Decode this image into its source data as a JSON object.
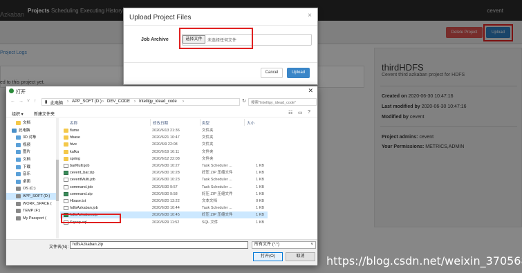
{
  "navbar": {
    "brand": "Azkaban",
    "items": [
      "Projects",
      "Scheduling",
      "Executing",
      "History"
    ],
    "user": "cevent"
  },
  "project_page": {
    "delete_label": "Delete Project",
    "upload_label": "Upload",
    "project_logs": "Project Logs",
    "no_flows": "ed to this project yet.",
    "info": {
      "title": "thirdHDFS",
      "description": "Cevent third azkaban project for HDFS",
      "created_label": "Created on",
      "created_value": "2020-06-30 10:47:16",
      "modified_label": "Last modified by",
      "modified_value": "2020-06-30 10:47:16",
      "modified_by_label": "Modified by",
      "modified_by_value": "cevent",
      "admins_label": "Project admins:",
      "admins_value": "cevent",
      "permissions_label": "Your Permissions:",
      "permissions_value": "METRICS,ADMIN"
    }
  },
  "modal": {
    "title": "Upload Project Files",
    "close": "×",
    "job_archive_label": "Job Archive",
    "choose_file": "选择文件",
    "no_file": "未选择任何文件",
    "cancel": "Cancel",
    "upload": "Upload"
  },
  "dialog": {
    "title": "打开",
    "close": "✕",
    "breadcrumb": [
      "此电脑",
      "APP_SOFT (D:)",
      "DEV_CODE",
      "Intelligy_idead_code"
    ],
    "search_placeholder": "搜索\"Intelligy_idead_code\"",
    "organize": "组织 ▾",
    "new_folder": "新建文件夹",
    "columns": {
      "name": "名称",
      "date": "修改日期",
      "type": "类型",
      "size": "大小"
    },
    "nav_items": [
      {
        "label": "文档",
        "icon": "folder"
      },
      {
        "label": "此电脑",
        "icon": "pc"
      },
      {
        "label": "3D 对象",
        "icon": "blue"
      },
      {
        "label": "视频",
        "icon": "blue"
      },
      {
        "label": "图片",
        "icon": "blue"
      },
      {
        "label": "文档",
        "icon": "blue"
      },
      {
        "label": "下载",
        "icon": "blue"
      },
      {
        "label": "音乐",
        "icon": "blue"
      },
      {
        "label": "桌面",
        "icon": "blue"
      },
      {
        "label": "OS (C:)",
        "icon": "drive"
      },
      {
        "label": "APP_SOFT (D:)",
        "icon": "drive"
      },
      {
        "label": "WORK_SPACE (",
        "icon": "drive"
      },
      {
        "label": "TEMP (F:)",
        "icon": "drive"
      },
      {
        "label": "My Passport (",
        "icon": "drive"
      }
    ],
    "files": [
      {
        "name": "flume",
        "date": "2020/6/13 21:36",
        "type": "文件夹",
        "size": "",
        "icon": "folder"
      },
      {
        "name": "hbase",
        "date": "2020/6/21 10:47",
        "type": "文件夹",
        "size": "",
        "icon": "folder"
      },
      {
        "name": "hive",
        "date": "2020/6/9 22:08",
        "type": "文件夹",
        "size": "",
        "icon": "folder"
      },
      {
        "name": "kafka",
        "date": "2020/6/19 16:11",
        "type": "文件夹",
        "size": "",
        "icon": "folder"
      },
      {
        "name": "spring",
        "date": "2020/6/12 22:08",
        "type": "文件夹",
        "size": "",
        "icon": "folder"
      },
      {
        "name": "barMulti.job",
        "date": "2020/6/30 10:27",
        "type": "Task Scheduler ...",
        "size": "1 KB",
        "icon": "file"
      },
      {
        "name": "cevent_bar.zip",
        "date": "2020/6/30 10:28",
        "type": "好压 ZIP 压缩文件",
        "size": "1 KB",
        "icon": "zip"
      },
      {
        "name": "ceventMulti.job",
        "date": "2020/6/30 10:23",
        "type": "Task Scheduler ...",
        "size": "1 KB",
        "icon": "file"
      },
      {
        "name": "command.job",
        "date": "2020/6/30 9:57",
        "type": "Task Scheduler ...",
        "size": "1 KB",
        "icon": "file"
      },
      {
        "name": "command.zip",
        "date": "2020/6/30 9:58",
        "type": "好压 ZIP 压缩文件",
        "size": "1 KB",
        "icon": "zip"
      },
      {
        "name": "Hbase.txt",
        "date": "2020/6/20 13:22",
        "type": "文本文档",
        "size": "0 KB",
        "icon": "file"
      },
      {
        "name": "hdfsAzkaban.job",
        "date": "2020/6/30 10:44",
        "type": "Task Scheduler ...",
        "size": "1 KB",
        "icon": "file"
      },
      {
        "name": "hdfsAzkaban.zip",
        "date": "2020/6/30 10:45",
        "type": "好压 ZIP 压缩文件",
        "size": "1 KB",
        "icon": "zip",
        "selected": true
      },
      {
        "name": "Sqoop.sql",
        "date": "2020/6/29 11:52",
        "type": "SQL 文件",
        "size": "1 KB",
        "icon": "file"
      }
    ],
    "filename_label": "文件名(N):",
    "filename_value": "hdfsAzkaban.zip",
    "filetype_value": "所有文件 (*.*)",
    "open": "打开(O)",
    "cancel": "取消"
  },
  "watermark": "https://blog.csdn.net/weixin_37056888"
}
